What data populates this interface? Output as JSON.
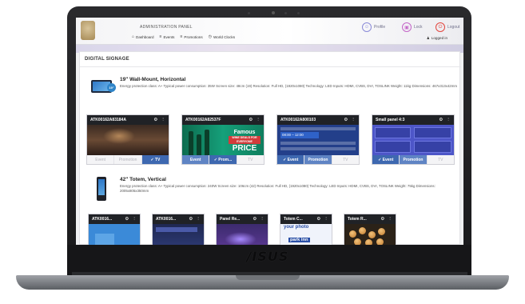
{
  "brand": {
    "laptop_logo": "/ISUS"
  },
  "header": {
    "title": "ADMINISTRATION PANEL",
    "nav": [
      {
        "label": "Dashboard",
        "icon": "home-icon"
      },
      {
        "label": "Events",
        "icon": "list-icon"
      },
      {
        "label": "Promotions",
        "icon": "list-icon"
      },
      {
        "label": "World Clocks",
        "icon": "clock-icon"
      }
    ],
    "actions": {
      "profile": "Profile",
      "lock": "Lock",
      "logout": "Logout"
    },
    "logged_in": "Logged in"
  },
  "page": {
    "title": "DIGITAL SIGNAGE"
  },
  "devices": [
    {
      "name": "19\" Wall-Mount, Horizontal",
      "badge": "19\"",
      "spec": "Energy protection class: A+ Typical power consumption: 35W Screen size: 48cm (19) Resolution: Full HD, (1920x1080) Technology: LED Inputs: HDMI, CVBS, DVI, TOSLINK Weight: 11kg Dimensions: 467x313x42mm"
    },
    {
      "name": "42\" Totem, Vertical",
      "spec": "Energy protection class: A+ Typical power consumption: 240W Screen size: 106cm (42) Resolution: Full HD, (1920x1080) Technology: LED Inputs: HDMI, CVBS, DVI, TOSLINK Weight: 75kg Dimensions: 2005x805x350mm"
    }
  ],
  "panels_row1": [
    {
      "title": "ATK00162A83184A",
      "tabs": [
        "Event",
        "Promotion",
        "✓ TV"
      ],
      "active": 2,
      "image_text": ""
    },
    {
      "title": "ATK00162A82537F",
      "tabs": [
        "Event",
        "✓ Prom...",
        "TV"
      ],
      "active": 1,
      "image_text": {
        "line1": "Famous",
        "line2": "WINE DEALS FOR EVERYONE",
        "line3": "PRICE"
      }
    },
    {
      "title": "ATK00162A800103",
      "tabs": [
        "✓ Event",
        "Promotion",
        "TV"
      ],
      "active": 0,
      "image_text": {
        "time": "08:00 – 12:00"
      }
    },
    {
      "title": "Small panel 4:3",
      "tabs": [
        "✓ Event",
        "Promotion",
        "TV"
      ],
      "active": 0,
      "image_text": ""
    }
  ],
  "panels_row2": [
    {
      "title": "ATK0016..."
    },
    {
      "title": "ATK0016..."
    },
    {
      "title": "Panel Re..."
    },
    {
      "title": "Totem C...",
      "image_text": {
        "line1": "your photo",
        "tag": "park inn"
      }
    },
    {
      "title": "Totem R..."
    }
  ],
  "icons": {
    "settings": "gear-icon",
    "menu": "kebab-menu-icon"
  },
  "colors": {
    "active_tab": "#3e68b0",
    "panel_header": "#202226",
    "logout": "#e2453d",
    "lock": "#c466c8",
    "profile": "#8b8bd8"
  }
}
